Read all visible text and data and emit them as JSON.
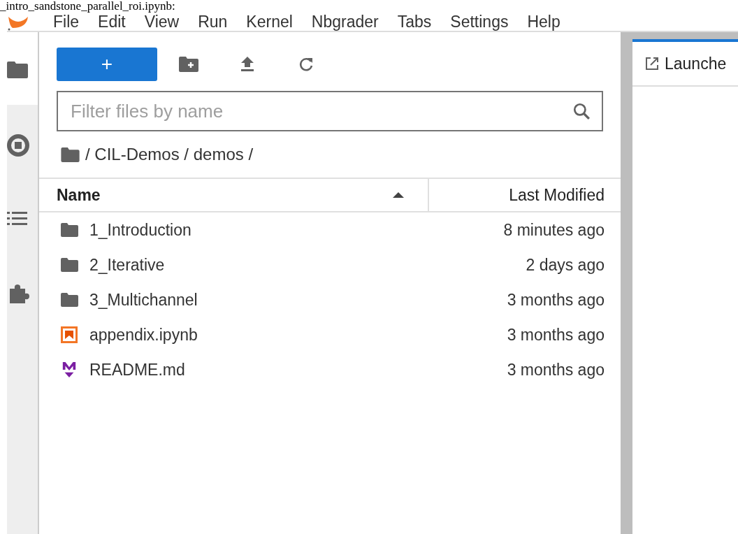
{
  "caption": "_intro_sandstone_parallel_roi.ipynb:",
  "menu_bar": [
    "File",
    "Edit",
    "View",
    "Run",
    "Kernel",
    "Nbgrader",
    "Tabs",
    "Settings",
    "Help"
  ],
  "activity_bar": [
    {
      "kind": "folder",
      "selected": true
    },
    {
      "kind": "running",
      "selected": false
    },
    {
      "kind": "toc",
      "selected": false
    },
    {
      "kind": "extensions",
      "selected": false
    }
  ],
  "toolbar": {
    "new_button": "+"
  },
  "filter": {
    "placeholder": "Filter files by name"
  },
  "breadcrumb": "/ CIL-Demos / demos /",
  "columns": {
    "name": "Name",
    "modified": "Last Modified"
  },
  "files": [
    {
      "kind": "folder",
      "name": "1_Introduction",
      "modified": "8 minutes ago"
    },
    {
      "kind": "folder",
      "name": "2_Iterative",
      "modified": "2 days ago"
    },
    {
      "kind": "folder",
      "name": "3_Multichannel",
      "modified": "3 months ago"
    },
    {
      "kind": "notebook",
      "name": "appendix.ipynb",
      "modified": "3 months ago"
    },
    {
      "kind": "markdown",
      "name": "README.md",
      "modified": "3 months ago"
    }
  ],
  "main_tab": {
    "label": "Launche",
    "selected": true
  }
}
